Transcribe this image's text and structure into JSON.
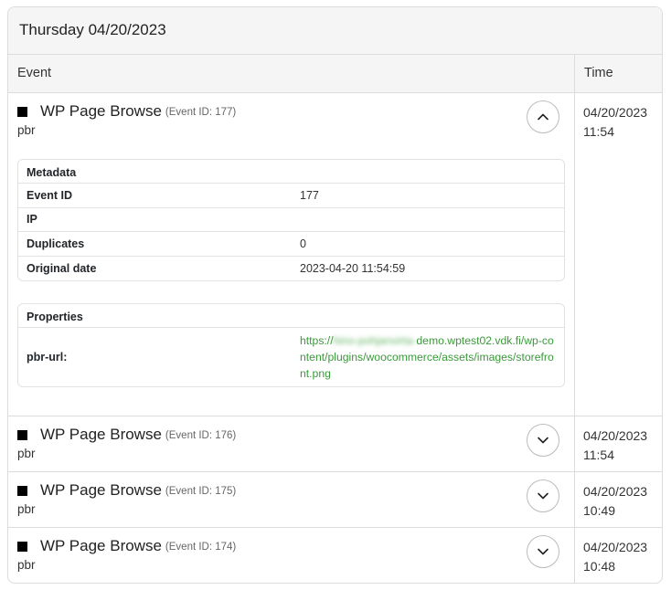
{
  "header": {
    "date": "Thursday 04/20/2023"
  },
  "columns": {
    "event": "Event",
    "time": "Time"
  },
  "expanded_event": {
    "name": "WP Page Browse",
    "id_label": "(Event ID: 177)",
    "type": "pbr",
    "date": "04/20/2023",
    "time": "11:54",
    "metadata": {
      "title": "Metadata",
      "rows": [
        {
          "key": "Event ID",
          "value": "177"
        },
        {
          "key": "IP",
          "value": ""
        },
        {
          "key": "Duplicates",
          "value": "0"
        },
        {
          "key": "Original date",
          "value": "2023-04-20 11:54:59"
        }
      ]
    },
    "properties": {
      "title": "Properties",
      "key": "pbr-url:",
      "url_prefix": "https://",
      "url_blurred": "hino-pohjanvirta-",
      "url_rest": "demo.wptest02.vdk.fi/wp-content/plugins/woocommerce/assets/images/storefront.png"
    }
  },
  "events": [
    {
      "name": "WP Page Browse",
      "id_label": "(Event ID: 176)",
      "type": "pbr",
      "date": "04/20/2023",
      "time": "11:54"
    },
    {
      "name": "WP Page Browse",
      "id_label": "(Event ID: 175)",
      "type": "pbr",
      "date": "04/20/2023",
      "time": "10:49"
    },
    {
      "name": "WP Page Browse",
      "id_label": "(Event ID: 174)",
      "type": "pbr",
      "date": "04/20/2023",
      "time": "10:48"
    }
  ],
  "icons": {
    "expand": "chevron-down-icon",
    "collapse": "chevron-up-icon",
    "event_marker": "square-icon"
  },
  "colors": {
    "link": "#3a9a3a",
    "border": "#dcdcdc",
    "header_bg": "#f5f5f5"
  }
}
